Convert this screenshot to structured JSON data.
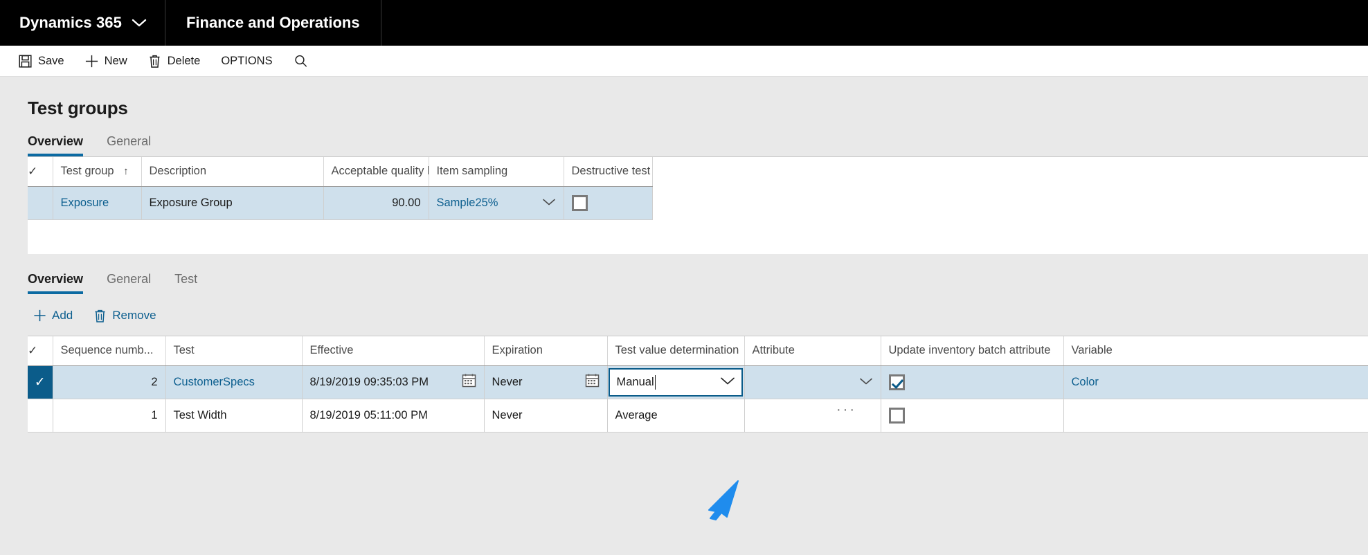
{
  "navbar": {
    "brand": "Dynamics 365",
    "brand_chevron_icon": "chevron-down-icon",
    "app": "Finance and Operations"
  },
  "commandbar": {
    "buttons": [
      {
        "label": "Save",
        "icon": "save-icon"
      },
      {
        "label": "New",
        "icon": "plus-icon"
      },
      {
        "label": "Delete",
        "icon": "trash-icon"
      },
      {
        "label": "OPTIONS",
        "icon": ""
      }
    ],
    "search_icon": "search-icon"
  },
  "page": {
    "title": "Test groups"
  },
  "header_tabs": [
    {
      "label": "Overview",
      "active": true
    },
    {
      "label": "General",
      "active": false
    }
  ],
  "upper_grid": {
    "columns": [
      {
        "label": "",
        "name": "row-select"
      },
      {
        "label": "Test group",
        "name": "test-group",
        "sort": "ascending",
        "sort_icon": "arrow-up-icon"
      },
      {
        "label": "Description",
        "name": "description"
      },
      {
        "label": "Acceptable quality l...",
        "name": "acceptable-quality-level",
        "align": "right"
      },
      {
        "label": "Item sampling",
        "name": "item-sampling"
      },
      {
        "label": "Destructive test",
        "name": "destructive-test"
      }
    ],
    "rows": [
      {
        "selected": true,
        "test_group": "Exposure",
        "description": "Exposure Group",
        "acceptable_quality_level": "90.00",
        "item_sampling": "Sample25%",
        "destructive_test_checked": false
      }
    ]
  },
  "detail_tabs": [
    {
      "label": "Overview",
      "active": true
    },
    {
      "label": "General",
      "active": false
    },
    {
      "label": "Test",
      "active": false
    }
  ],
  "detail_toolbar": {
    "buttons": [
      {
        "label": "Add",
        "icon": "plus-icon"
      },
      {
        "label": "Remove",
        "icon": "trash-icon"
      }
    ]
  },
  "lower_grid": {
    "columns": [
      {
        "label": "",
        "name": "row-select"
      },
      {
        "label": "Sequence numb...",
        "name": "sequence-number",
        "align": "right"
      },
      {
        "label": "Test",
        "name": "test"
      },
      {
        "label": "Effective",
        "name": "effective"
      },
      {
        "label": "Expiration",
        "name": "expiration"
      },
      {
        "label": "Test value determination",
        "name": "test-value-determination"
      },
      {
        "label": "Attribute",
        "name": "attribute"
      },
      {
        "label": "Update inventory batch attribute",
        "name": "update-inventory-batch-attribute"
      },
      {
        "label": "Variable",
        "name": "variable"
      }
    ],
    "rows": [
      {
        "selected": true,
        "sequence_number": "2",
        "test": "CustomerSpecs",
        "effective": "8/19/2019 09:35:03 PM",
        "expiration": "Never",
        "test_value_determination": "Manual",
        "attribute": "",
        "update_inventory_batch_attribute_checked": true,
        "variable": "Color"
      },
      {
        "selected": false,
        "sequence_number": "1",
        "test": "Test Width",
        "effective": "8/19/2019 05:11:00 PM",
        "expiration": "Never",
        "test_value_determination": "Average",
        "attribute": "",
        "update_inventory_batch_attribute_checked": false,
        "variable": ""
      }
    ]
  },
  "resize_handle": {
    "label": "···",
    "name": "grid-resize-handle"
  },
  "colors": {
    "accent": "#0b6aa2",
    "link": "#0d5f8f",
    "selected_row": "#cfe0ec",
    "selector_fill": "#0b5c8a",
    "nav_bg": "#000000",
    "page_bg": "#e9e9e9",
    "cursor": "#1f8ced"
  }
}
